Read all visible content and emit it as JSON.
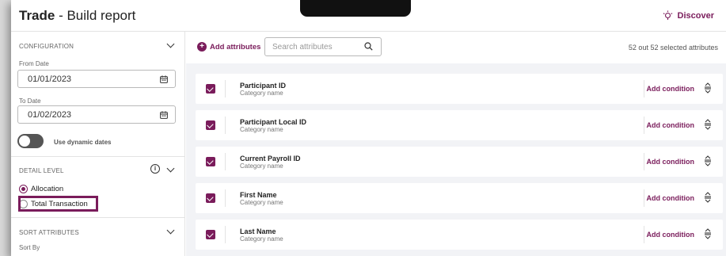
{
  "header": {
    "title_bold": "Trade",
    "title_rest": " - Build report",
    "discover_label": "Discover"
  },
  "configuration": {
    "heading": "CONFIGURATION",
    "from_label": "From Date",
    "from_value": "01/01/2023",
    "to_label": "To Date",
    "to_value": "01/02/2023",
    "dynamic_label": "Use dynamic dates"
  },
  "detail_level": {
    "heading": "DETAIL LEVEL",
    "info_glyph": "i",
    "options": [
      {
        "label": "Allocation",
        "selected": true
      },
      {
        "label": "Total Transaction",
        "selected": false
      }
    ]
  },
  "sort": {
    "heading": "SORT ATTRIBUTES",
    "sort_by_label": "Sort By"
  },
  "toolbar": {
    "add_label": "Add attributes",
    "search_placeholder": "Search attributes",
    "count_text": "52 out 52 selected attributes"
  },
  "attributes": [
    {
      "name": "Participant ID",
      "category": "Category name",
      "action": "Add condition"
    },
    {
      "name": "Participant Local ID",
      "category": "Category name",
      "action": "Add condition"
    },
    {
      "name": "Current Payroll ID",
      "category": "Category name",
      "action": "Add condition"
    },
    {
      "name": "First Name",
      "category": "Category name",
      "action": "Add condition"
    },
    {
      "name": "Last Name",
      "category": "Category name",
      "action": "Add condition"
    }
  ],
  "colors": {
    "accent": "#7a1c5b"
  }
}
